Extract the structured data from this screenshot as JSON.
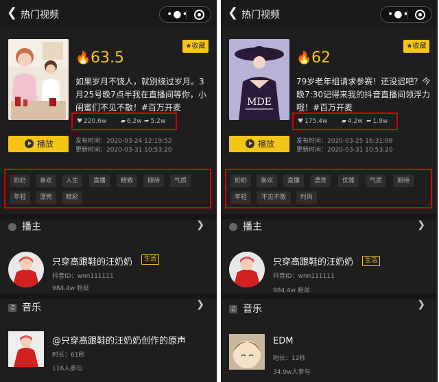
{
  "panels": [
    {
      "nav": {
        "back_icon": "chevron-left-icon",
        "title": "热门视频",
        "menu_icon": "more-dots-icon",
        "close_icon": "target-icon"
      },
      "hot_value": "63.5",
      "favorite_label": "收藏",
      "description": "如果岁月不饶人，就别绕过岁月。3月25号晚7点半我在直播间等你，小闺蜜们不见不散！#百万开麦",
      "stats": {
        "likes": "220.6w",
        "comments": "6.2w",
        "shares": "5.2w"
      },
      "play_label": "播放",
      "publish_time": "发布时间：2020-03-24 12:19:52",
      "update_time": "更新时间：2020-03-31 10:53:20",
      "tags": [
        "奶奶",
        "喜欢",
        "人生",
        "直播",
        "精致",
        "期待",
        "气质",
        "年轻",
        "漂亮",
        "精彩"
      ],
      "host_section": "播主",
      "host": {
        "name": "只穿高跟鞋的汪奶奶",
        "badge": "生活",
        "douyin_id": "抖音ID：wnn111111",
        "fans": "984.4w 粉丝"
      },
      "music_section": "音乐",
      "music": {
        "title": "@只穿高跟鞋的汪奶奶创作的原声",
        "duration": "时长：61秒",
        "participants": "116人参与"
      }
    },
    {
      "nav": {
        "back_icon": "chevron-left-icon",
        "title": "热门视频",
        "menu_icon": "more-dots-icon",
        "close_icon": "target-icon"
      },
      "hot_value": "62",
      "favorite_label": "收藏",
      "description": "79岁老年组请求参赛！还没迟吧？今晚7:30记得来我的抖音直播间领浮力哦！#百万开麦",
      "stats": {
        "likes": "175.4w",
        "comments": "4.2w",
        "shares": "1.9w"
      },
      "play_label": "播放",
      "publish_time": "发布时间：2020-03-25 16:31:08",
      "update_time": "更新时间：2020-03-31 10:53:20",
      "tags": [
        "奶奶",
        "喜欢",
        "直播",
        "漂亮",
        "优雅",
        "气质",
        "期待",
        "年轻",
        "不见不散",
        "时尚"
      ],
      "host_section": "播主",
      "host": {
        "name": "只穿高跟鞋的汪奶奶",
        "badge": "生活",
        "douyin_id": "抖音ID：wnn111111",
        "fans": "984.4w 粉丝"
      },
      "music_section": "音乐",
      "music": {
        "title": "EDM",
        "duration": "时长：12秒",
        "participants": "34.9w人参与"
      },
      "cover_caption": "MDE"
    }
  ],
  "colors": {
    "accent": "#f5c518",
    "highlight_box": "#d90000",
    "background": "#1e1e1e"
  }
}
